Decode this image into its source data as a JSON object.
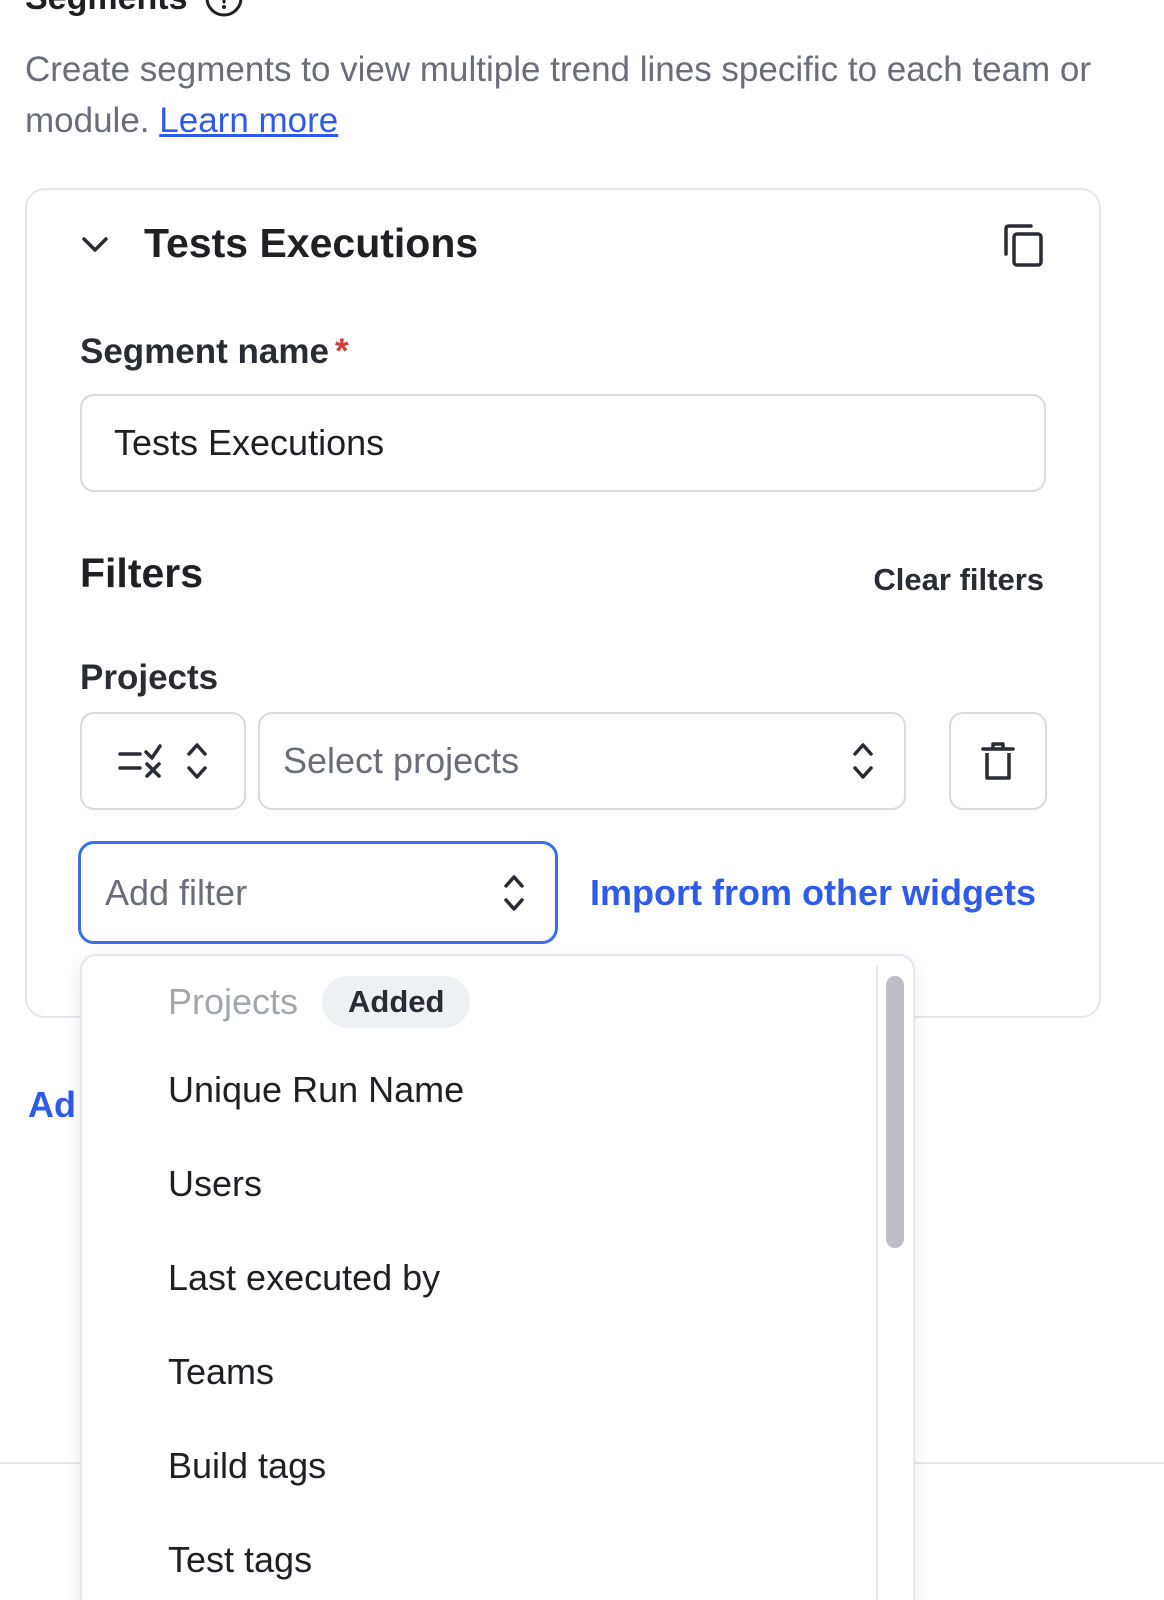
{
  "section": {
    "title": "Segments",
    "description": "Create segments to view multiple trend lines specific to each team or module.",
    "learn_more": "Learn more"
  },
  "segment": {
    "title": "Tests Executions",
    "name_label": "Segment name",
    "required_mark": "*",
    "name_value": "Tests Executions"
  },
  "filters": {
    "title": "Filters",
    "clear_label": "Clear filters",
    "projects_label": "Projects",
    "projects_placeholder": "Select projects",
    "add_filter_placeholder": "Add filter",
    "import_label": "Import from other widgets"
  },
  "add_segment_label": "Ad",
  "dropdown": {
    "items": [
      {
        "label": "Projects",
        "badge": "Added",
        "disabled": true
      },
      {
        "label": "Unique Run Name"
      },
      {
        "label": "Users"
      },
      {
        "label": "Last executed by"
      },
      {
        "label": "Teams"
      },
      {
        "label": "Build tags"
      },
      {
        "label": "Test tags"
      }
    ]
  },
  "colors": {
    "accent": "#2f5bea",
    "focus_border": "#3d6de8",
    "required": "#d93a3a"
  }
}
